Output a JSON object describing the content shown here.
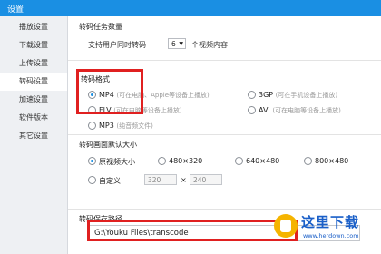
{
  "window": {
    "title": "设置"
  },
  "sidebar": {
    "items": [
      {
        "label": "播放设置",
        "active": false
      },
      {
        "label": "下载设置",
        "active": false
      },
      {
        "label": "上传设置",
        "active": false
      },
      {
        "label": "转码设置",
        "active": true
      },
      {
        "label": "加速设置",
        "active": false
      },
      {
        "label": "软件版本",
        "active": false
      },
      {
        "label": "其它设置",
        "active": false
      }
    ]
  },
  "transcode_count": {
    "title": "转码任务数量",
    "prefix": "支持用户同时转码",
    "value": "6",
    "suffix": "个视频内容"
  },
  "format": {
    "title": "转码格式",
    "options": [
      {
        "label": "MP4",
        "hint": "(可在电脑、Apple等设备上播放)",
        "selected": true
      },
      {
        "label": "3GP",
        "hint": "(可在手机设备上播放)",
        "selected": false
      },
      {
        "label": "FLV",
        "hint": "(可在电脑等设备上播放)",
        "selected": false
      },
      {
        "label": "AVI",
        "hint": "(可在电脑等设备上播放)",
        "selected": false
      },
      {
        "label": "MP3",
        "hint": "(纯音频文件)",
        "selected": false
      }
    ]
  },
  "size": {
    "title": "转码画面默认大小",
    "options": [
      {
        "label": "原视频大小",
        "selected": true
      },
      {
        "label": "480×320",
        "selected": false
      },
      {
        "label": "640×480",
        "selected": false
      },
      {
        "label": "800×480",
        "selected": false
      }
    ],
    "custom_label": "自定义",
    "custom_width": "320",
    "custom_sep": "×",
    "custom_height": "240"
  },
  "save_path": {
    "title": "转码保存路径",
    "value": "G:\\Youku Files\\transcode"
  },
  "watermark": {
    "text": "这里下载",
    "url": "www.herdown.com"
  },
  "colors": {
    "titlebar": "#1a8fe3",
    "highlight": "#e02020",
    "watermark": "#1a5fc8"
  }
}
